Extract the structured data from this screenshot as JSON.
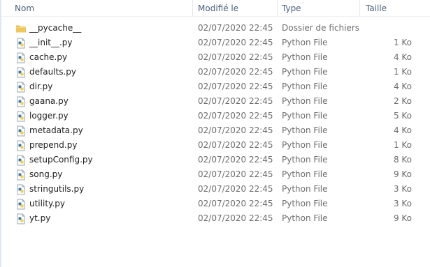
{
  "columns": {
    "name": "Nom",
    "modified": "Modifié le",
    "type": "Type",
    "size": "Taille"
  },
  "sort_indicator": "^",
  "files": [
    {
      "name": "__pycache__",
      "modified": "02/07/2020 22:45",
      "type": "Dossier de fichiers",
      "size": "",
      "icon": "folder-icon"
    },
    {
      "name": "__init__.py",
      "modified": "02/07/2020 22:45",
      "type": "Python File",
      "size": "1 Ko",
      "icon": "python-file-icon"
    },
    {
      "name": "cache.py",
      "modified": "02/07/2020 22:45",
      "type": "Python File",
      "size": "4 Ko",
      "icon": "python-file-icon"
    },
    {
      "name": "defaults.py",
      "modified": "02/07/2020 22:45",
      "type": "Python File",
      "size": "1 Ko",
      "icon": "python-file-icon"
    },
    {
      "name": "dir.py",
      "modified": "02/07/2020 22:45",
      "type": "Python File",
      "size": "4 Ko",
      "icon": "python-file-icon"
    },
    {
      "name": "gaana.py",
      "modified": "02/07/2020 22:45",
      "type": "Python File",
      "size": "2 Ko",
      "icon": "python-file-icon"
    },
    {
      "name": "logger.py",
      "modified": "02/07/2020 22:45",
      "type": "Python File",
      "size": "5 Ko",
      "icon": "python-file-icon"
    },
    {
      "name": "metadata.py",
      "modified": "02/07/2020 22:45",
      "type": "Python File",
      "size": "4 Ko",
      "icon": "python-file-icon"
    },
    {
      "name": "prepend.py",
      "modified": "02/07/2020 22:45",
      "type": "Python File",
      "size": "1 Ko",
      "icon": "python-file-icon"
    },
    {
      "name": "setupConfig.py",
      "modified": "02/07/2020 22:45",
      "type": "Python File",
      "size": "8 Ko",
      "icon": "python-file-icon"
    },
    {
      "name": "song.py",
      "modified": "02/07/2020 22:45",
      "type": "Python File",
      "size": "9 Ko",
      "icon": "python-file-icon"
    },
    {
      "name": "stringutils.py",
      "modified": "02/07/2020 22:45",
      "type": "Python File",
      "size": "3 Ko",
      "icon": "python-file-icon"
    },
    {
      "name": "utility.py",
      "modified": "02/07/2020 22:45",
      "type": "Python File",
      "size": "3 Ko",
      "icon": "python-file-icon"
    },
    {
      "name": "yt.py",
      "modified": "02/07/2020 22:45",
      "type": "Python File",
      "size": "9 Ko",
      "icon": "python-file-icon"
    }
  ],
  "colors": {
    "header_text": "#4c607a",
    "folder_yellow": "#f0c75e",
    "python_blue": "#3b75b0",
    "python_yellow": "#f2cf45",
    "meta_text": "#6d6d6d"
  }
}
